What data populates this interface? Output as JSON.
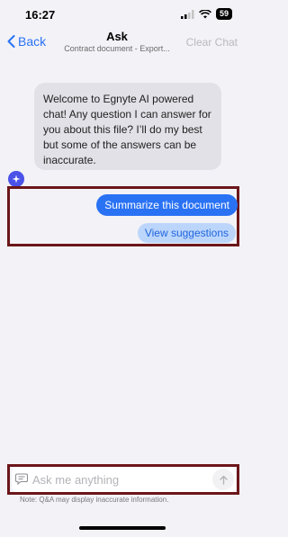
{
  "status_bar": {
    "time": "16:27",
    "battery": "59"
  },
  "nav": {
    "back_label": "Back",
    "title": "Ask",
    "subtitle": "Contract document - Export...",
    "clear_label": "Clear Chat"
  },
  "chat": {
    "ai_message": "Welcome to Egnyte AI powered chat! Any question I can answer for you about this file? I’ll do my best but some of the answers can be inaccurate."
  },
  "suggestions": {
    "summarize_label": "Summarize this document",
    "view_label": "View suggestions"
  },
  "composer": {
    "placeholder": "Ask me anything",
    "disclaimer": "Note: Q&A may display inaccurate information."
  },
  "colors": {
    "accent": "#2a72f4",
    "highlight_border": "#6b1619",
    "avatar": "#4a52e8"
  }
}
